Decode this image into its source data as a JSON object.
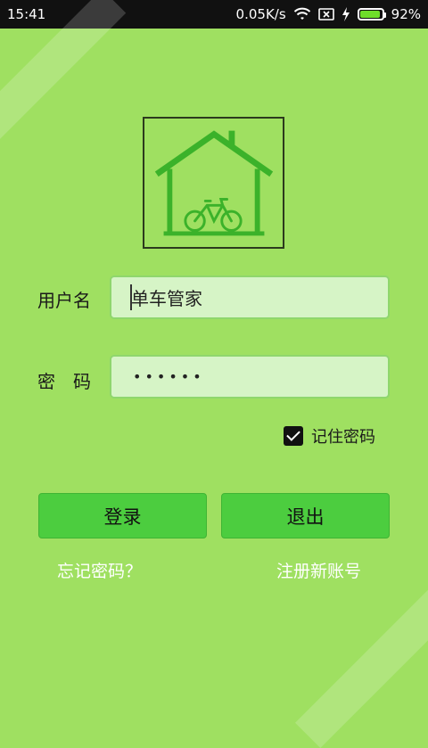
{
  "status_bar": {
    "time": "15:41",
    "net_speed": "0.05K/s",
    "battery_percent": "92%",
    "battery_level": 0.92,
    "icons": [
      "wifi-icon",
      "sim-card-icon",
      "charging-icon",
      "battery-icon"
    ]
  },
  "form": {
    "username_label": "用户名",
    "username_value": "单车管家",
    "password_label": "密码",
    "password_value": "••••••",
    "remember_label": "记住密码",
    "remember_checked": true
  },
  "buttons": {
    "login_label": "登录",
    "exit_label": "退出"
  },
  "links": {
    "forgot_label": "忘记密码？",
    "register_label": "注册新账号"
  },
  "colors": {
    "background": "#9fe061",
    "accent_button": "#4ccd3f",
    "field_bg": "#d6f4c6",
    "logo_green": "#3bb22a"
  }
}
